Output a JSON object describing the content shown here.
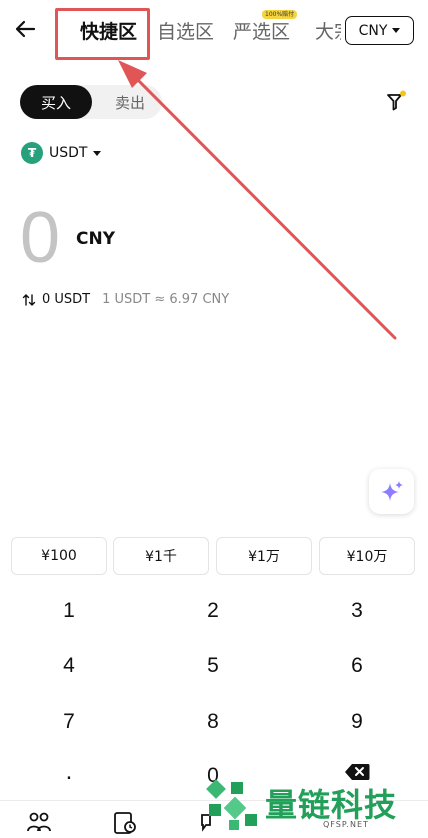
{
  "header": {
    "tabs": [
      {
        "label": "快捷区",
        "active": true
      },
      {
        "label": "自选区",
        "active": false
      },
      {
        "label": "严选区",
        "active": false,
        "badge": "100%赔付"
      },
      {
        "label": "大宗",
        "active": false
      }
    ],
    "currency": "CNY"
  },
  "mode": {
    "buy_label": "买入",
    "sell_label": "卖出",
    "selected": "buy"
  },
  "asset": {
    "symbol": "USDT",
    "icon_glyph": "₮",
    "icon_color": "#26a17b"
  },
  "amount": {
    "value": "0",
    "currency": "CNY"
  },
  "conversion": {
    "value": "0 USDT",
    "rate": "1 USDT ≈ 6.97 CNY"
  },
  "presets": [
    "¥100",
    "¥1千",
    "¥1万",
    "¥10万"
  ],
  "keypad": {
    "rows": [
      [
        "1",
        "2",
        "3"
      ],
      [
        "4",
        "5",
        "6"
      ],
      [
        "7",
        "8",
        "9"
      ],
      [
        ".",
        "0",
        "backspace"
      ]
    ]
  },
  "annotation": {
    "color": "#e05555"
  },
  "watermark": {
    "text": "量链科技",
    "url": "QFSP.NET",
    "color": "#22a05a"
  }
}
